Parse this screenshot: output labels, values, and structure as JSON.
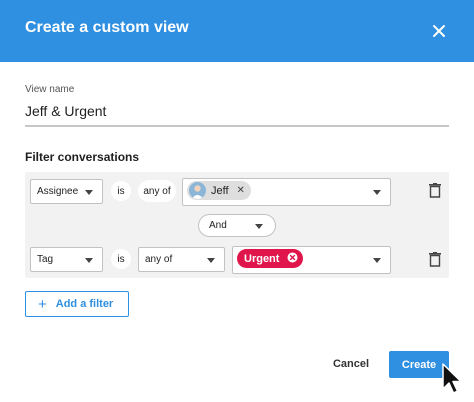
{
  "dialog": {
    "title": "Create a custom view",
    "view_name": {
      "label": "View name",
      "value": "Jeff & Urgent"
    },
    "filter_section_title": "Filter conversations",
    "filters": [
      {
        "field": "Assignee",
        "connector": "is",
        "operator": "any of",
        "values": [
          {
            "label": "Jeff",
            "type": "user",
            "icon": "avatar"
          }
        ]
      },
      {
        "field": "Tag",
        "connector": "is",
        "operator": "any of",
        "values": [
          {
            "label": "Urgent",
            "type": "tag",
            "color": "#e0154c"
          }
        ]
      }
    ],
    "join_operator": "And",
    "add_filter_label": "Add a filter",
    "cancel_label": "Cancel",
    "create_label": "Create",
    "colors": {
      "accent": "#2f8fe0",
      "urgent_tag": "#e0154c"
    }
  }
}
